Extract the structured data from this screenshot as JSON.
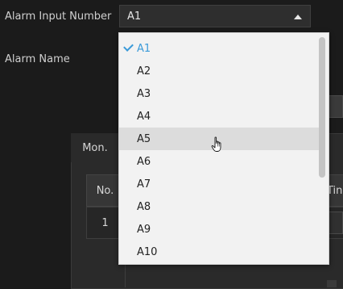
{
  "form": {
    "alarm_input_label": "Alarm Input Number",
    "alarm_input_value": "A1",
    "alarm_name_label": "Alarm Name"
  },
  "tabs": {
    "mon_label": "Mon."
  },
  "table": {
    "headers": {
      "no": "No.",
      "time_partial": "Tin"
    },
    "rows": [
      {
        "no": "1"
      }
    ]
  },
  "dropdown": {
    "selected": "A1",
    "hovered": "A5",
    "options": [
      "A1",
      "A2",
      "A3",
      "A4",
      "A5",
      "A6",
      "A7",
      "A8",
      "A9",
      "A10"
    ]
  },
  "colors": {
    "accent": "#3a9ad9",
    "dropdown_bg": "#f2f2f2",
    "hover_bg": "#dcdcdc",
    "page_bg": "#1b1b1b"
  },
  "icons": {
    "check": "check-icon",
    "caret": "caret-up-icon",
    "cursor": "hand-pointer-icon"
  }
}
